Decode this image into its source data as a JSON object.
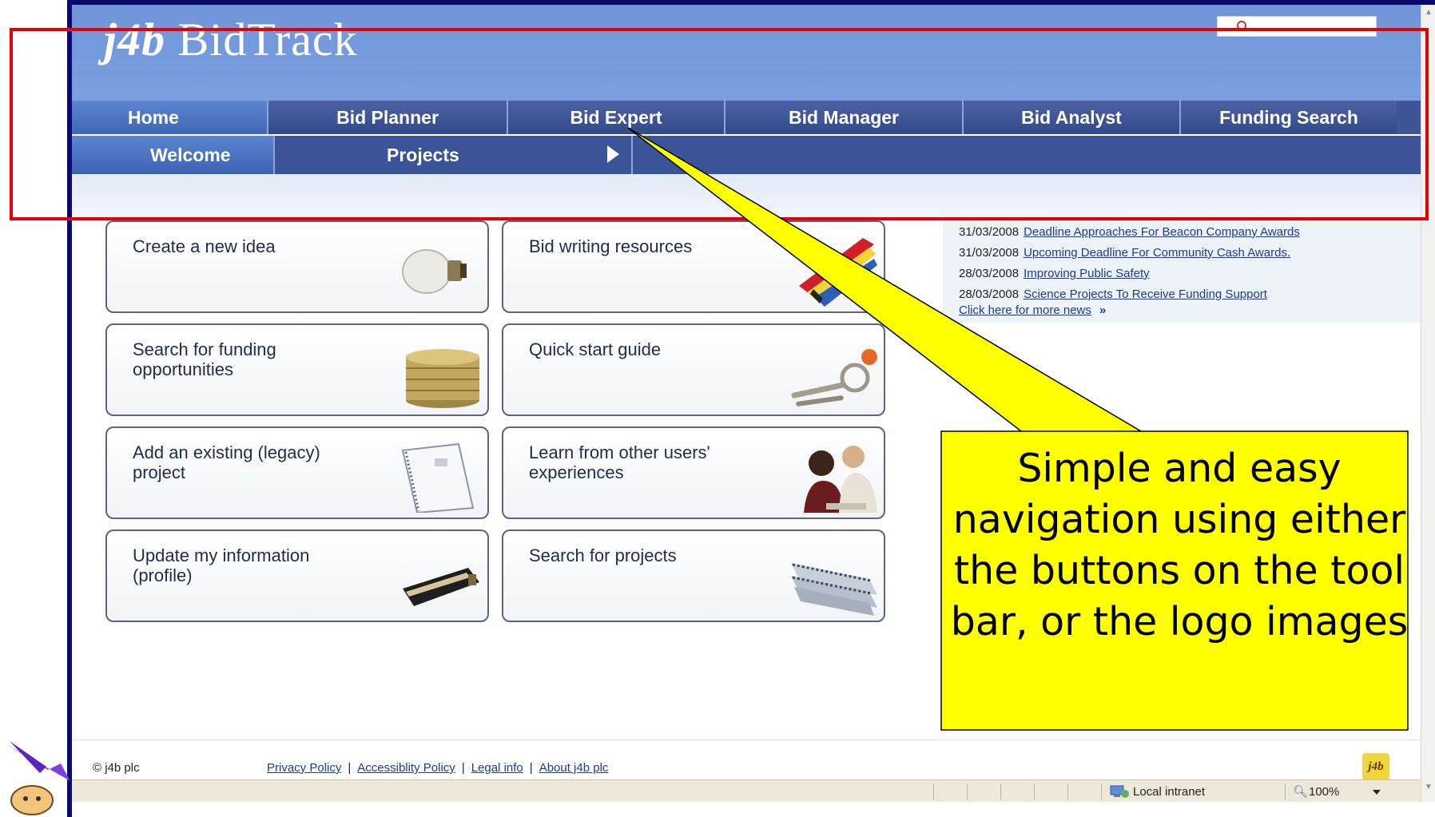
{
  "header": {
    "logo": {
      "prefix": "j4b",
      "text": "BidTrack"
    }
  },
  "nav_main": [
    {
      "label": "Home",
      "active": true
    },
    {
      "label": "Bid Planner",
      "active": false
    },
    {
      "label": "Bid Expert",
      "active": false
    },
    {
      "label": "Bid Manager",
      "active": false
    },
    {
      "label": "Bid Analyst",
      "active": false
    },
    {
      "label": "Funding Search",
      "active": false
    }
  ],
  "nav_sub": {
    "welcome": "Welcome",
    "projects": "Projects"
  },
  "tiles": [
    {
      "label": "Create a new idea",
      "icon": "lightbulb-icon"
    },
    {
      "label": "Bid writing resources",
      "icon": "books-icon"
    },
    {
      "label": "Search for funding opportunities",
      "icon": "coins-icon"
    },
    {
      "label": "Quick start guide",
      "icon": "keys-icon"
    },
    {
      "label": "Add an existing (legacy) project",
      "icon": "document-icon"
    },
    {
      "label": "Learn from other users' experiences",
      "icon": "people-icon"
    },
    {
      "label": "Update my information (profile)",
      "icon": "wallet-icon"
    },
    {
      "label": "Search for projects",
      "icon": "binders-icon"
    }
  ],
  "news": {
    "items": [
      {
        "date": "31/03/2008",
        "title": "Deadline Approaches For Beacon Company Awards"
      },
      {
        "date": "31/03/2008",
        "title": "Upcoming Deadline For Community Cash Awards."
      },
      {
        "date": "28/03/2008",
        "title": "Improving Public Safety"
      },
      {
        "date": "28/03/2008",
        "title": "Science Projects To Receive Funding Support"
      }
    ],
    "more": "Click here for more news",
    "more_arrow": "»"
  },
  "footer": {
    "copyright": "© j4b plc",
    "links": [
      "Privacy Policy",
      "Accessiblity Policy",
      "Legal info",
      "About j4b plc"
    ],
    "badge": "j4b"
  },
  "status_bar": {
    "zone": "Local intranet",
    "zoom": "100%"
  },
  "callout": {
    "text": "Simple and easy navigation using either the buttons on the tool bar, or the logo images",
    "fill": "#ffff00",
    "highlight_color": "#e60000"
  }
}
